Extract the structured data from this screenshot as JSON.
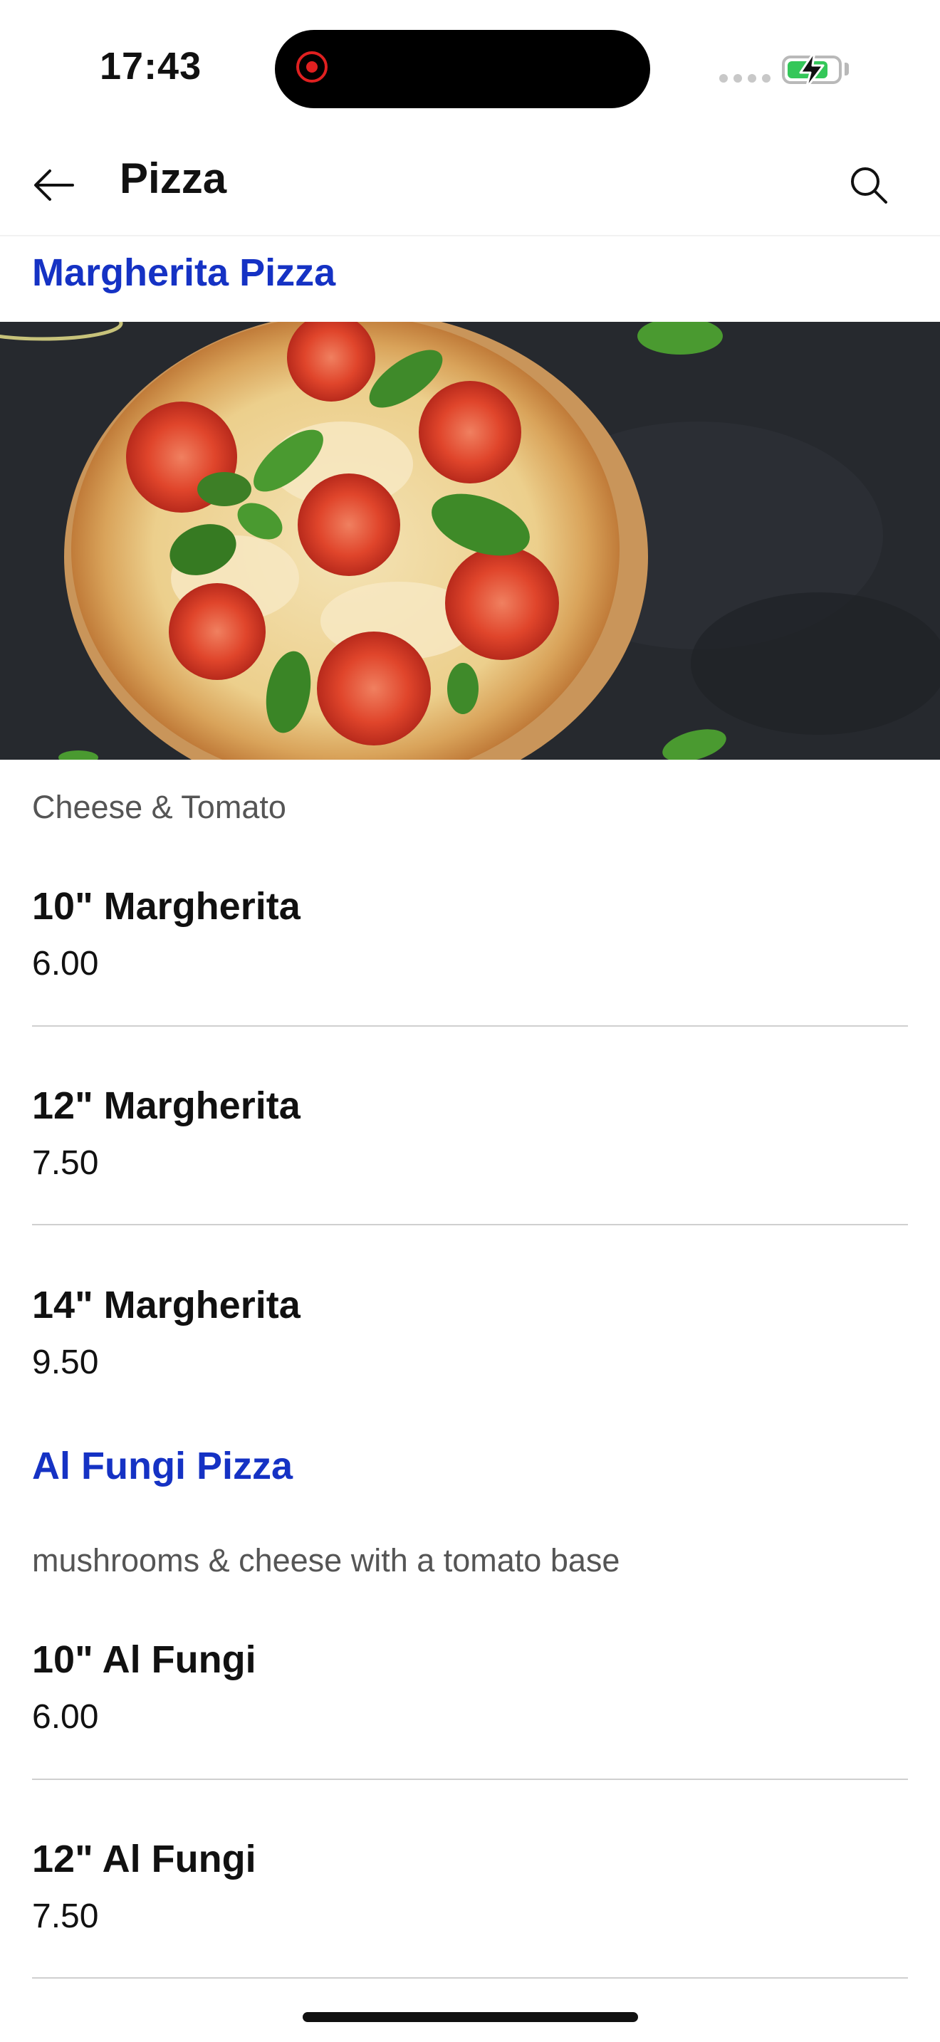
{
  "status_bar": {
    "time": "17:43"
  },
  "header": {
    "title": "Pizza",
    "back_icon": "arrow-left-icon",
    "search_icon": "search-icon"
  },
  "sections": [
    {
      "title": "Margherita Pizza",
      "description": "Cheese & Tomato",
      "image": "margherita-pizza-photo",
      "items": [
        {
          "name": "10\" Margherita",
          "price": "6.00"
        },
        {
          "name": "12\" Margherita",
          "price": "7.50"
        },
        {
          "name": "14\" Margherita",
          "price": "9.50"
        }
      ]
    },
    {
      "title": "Al Fungi Pizza",
      "description": "mushrooms & cheese with a tomato base",
      "items": [
        {
          "name": "10\" Al Fungi",
          "price": "6.00"
        },
        {
          "name": "12\" Al Fungi",
          "price": "7.50"
        }
      ]
    }
  ],
  "colors": {
    "section_title": "#1532c4",
    "battery": "#34c759"
  }
}
